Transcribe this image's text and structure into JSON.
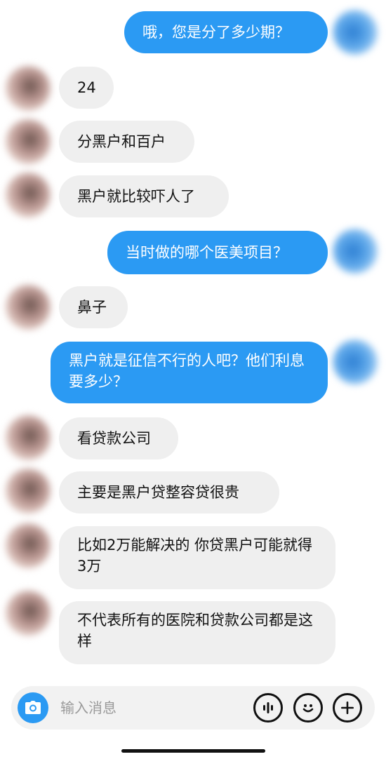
{
  "messages": [
    {
      "dir": "out",
      "text": "哦，您是分了多少期？"
    },
    {
      "dir": "in",
      "text": "24"
    },
    {
      "dir": "in",
      "text": "分黑户和百户"
    },
    {
      "dir": "in",
      "text": "黑户就比较吓人了"
    },
    {
      "dir": "out",
      "text": "当时做的哪个医美项目？"
    },
    {
      "dir": "in",
      "text": "鼻子"
    },
    {
      "dir": "out",
      "text": "黑户就是征信不行的人吧？他们利息要多少？"
    },
    {
      "dir": "in",
      "text": "看贷款公司"
    },
    {
      "dir": "in",
      "text": "主要是黑户贷整容贷很贵"
    },
    {
      "dir": "in",
      "text": "比如2万能解决的 你贷黑户可能就得3万"
    },
    {
      "dir": "in",
      "text": "不代表所有的医院和贷款公司都是这样"
    }
  ],
  "input": {
    "placeholder": "输入消息",
    "camera_icon": "camera-icon",
    "voice_icon": "voice-wave-icon",
    "emoji_icon": "smiley-icon",
    "plus_icon": "plus-icon"
  },
  "colors": {
    "outgoing_bubble": "#2b9af3",
    "incoming_bubble": "#efefef",
    "input_bar": "#f2f2f2"
  }
}
